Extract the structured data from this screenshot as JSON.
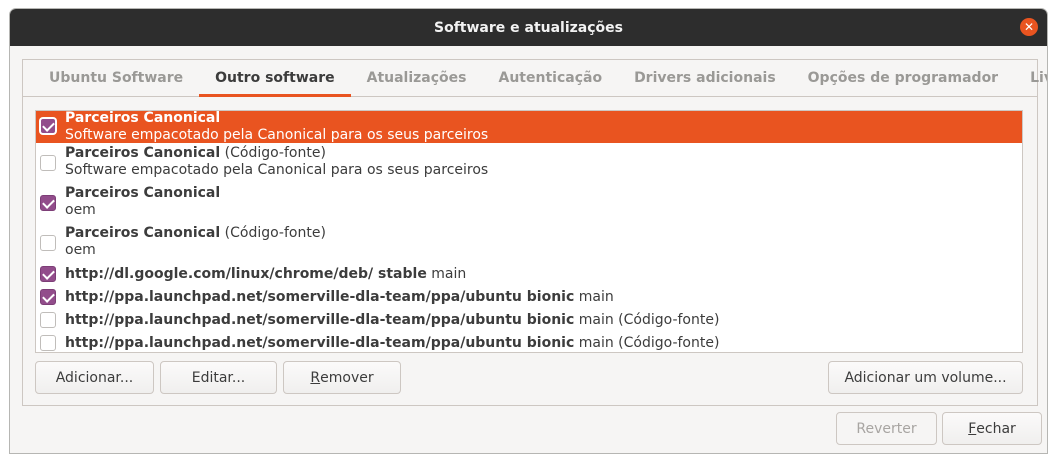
{
  "window": {
    "title": "Software e atualizações"
  },
  "tabs": [
    {
      "label": "Ubuntu Software"
    },
    {
      "label": "Outro software"
    },
    {
      "label": "Atualizações"
    },
    {
      "label": "Autenticação"
    },
    {
      "label": "Drivers adicionais"
    },
    {
      "label": "Opções de programador"
    },
    {
      "label": "Livepatch"
    }
  ],
  "active_tab": "Outro software",
  "sources": [
    {
      "checked": true,
      "selected": true,
      "title": "Parceiros Canonical",
      "suffix": "",
      "subtitle": "Software empacotado pela Canonical para os seus parceiros"
    },
    {
      "checked": false,
      "selected": false,
      "title": "Parceiros Canonical",
      "suffix": " (Código-fonte)",
      "subtitle": "Software empacotado pela Canonical para os seus parceiros"
    },
    {
      "checked": true,
      "selected": false,
      "title": "Parceiros Canonical",
      "suffix": "",
      "subtitle": "oem"
    },
    {
      "checked": false,
      "selected": false,
      "title": "Parceiros Canonical",
      "suffix": " (Código-fonte)",
      "subtitle": "oem"
    },
    {
      "checked": true,
      "selected": false,
      "title": "http://dl.google.com/linux/chrome/deb/ stable",
      "suffix": " main",
      "subtitle": ""
    },
    {
      "checked": true,
      "selected": false,
      "title": "http://ppa.launchpad.net/somerville-dla-team/ppa/ubuntu bionic",
      "suffix": " main",
      "subtitle": ""
    },
    {
      "checked": false,
      "selected": false,
      "title": "http://ppa.launchpad.net/somerville-dla-team/ppa/ubuntu bionic",
      "suffix": " main (Código-fonte)",
      "subtitle": ""
    },
    {
      "checked": false,
      "selected": false,
      "title": "http://ppa.launchpad.net/somerville-dla-team/ppa/ubuntu bionic",
      "suffix": " main (Código-fonte)",
      "subtitle": ""
    }
  ],
  "buttons": {
    "add": "Adicionar...",
    "edit": "Editar...",
    "remove_pre": "",
    "remove_u": "R",
    "remove_post": "emover",
    "add_volume": "Adicionar um volume...",
    "revert": "Reverter",
    "close_u": "F",
    "close_post": "echar"
  },
  "colors": {
    "accent": "#e95420",
    "checkbox": "#924d8b",
    "titlebar": "#2d2d2d"
  }
}
